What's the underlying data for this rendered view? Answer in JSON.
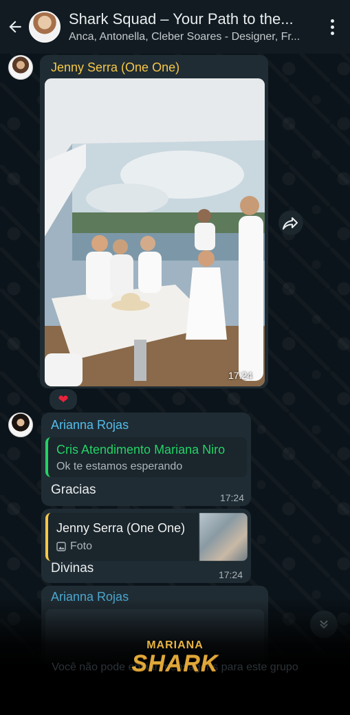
{
  "header": {
    "title": "Shark Squad – Your Path to the...",
    "subtitle": "Anca, Antonella, Cleber Soares - Designer, Fr...",
    "back_icon": "back-arrow-icon",
    "menu_icon": "more-vertical-icon"
  },
  "messages": [
    {
      "sender": "Jenny Serra (One One)",
      "type": "photo",
      "time": "17:24",
      "reaction": "❤"
    },
    {
      "sender": "Arianna Rojas",
      "reply_to": {
        "author": "Cris Atendimento Mariana Niro",
        "text": "Ok te estamos esperando"
      },
      "text": "Gracias",
      "time": "17:24"
    },
    {
      "reply_to": {
        "author": "Jenny Serra (One One)",
        "type_label": "Foto"
      },
      "text": "Divinas",
      "time": "17:24"
    },
    {
      "sender": "Arianna Rojas",
      "type": "photo"
    }
  ],
  "footer": {
    "notice": "Você não pode enviar mensagens para este grupo",
    "brand_top": "MARIANA",
    "brand_main": "SHARK"
  },
  "colors": {
    "sender_jenny": "#f6c847",
    "sender_arianna": "#53bdeb",
    "quote_green": "#25d366",
    "bubble": "#202c33",
    "brand_gold": "#e0a83a"
  }
}
